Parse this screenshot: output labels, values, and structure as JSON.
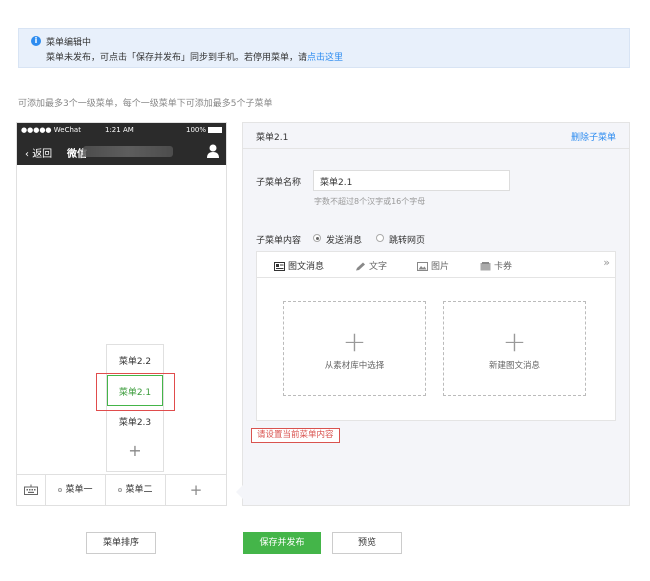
{
  "notice": {
    "title": "菜单编辑中",
    "desc_text": "菜单未发布，可点击「保存并发布」同步到手机。若停用菜单，请",
    "desc_link": "点击这里"
  },
  "tip": "可添加最多3个一级菜单，每个一级菜单下可添加最多5个子菜单",
  "phone": {
    "status": {
      "carrier": "●●●●● WeChat",
      "time": "1:21 AM",
      "battery": "100%"
    },
    "nav": {
      "back": "返回",
      "title": "微信"
    },
    "submenu": [
      "菜单2.2",
      "菜单2.1",
      "菜单2.3"
    ],
    "submenu_plus": "+",
    "menus": [
      "菜单一",
      "菜单二"
    ],
    "menu_plus": "+"
  },
  "editor": {
    "title": "菜单2.1",
    "delete": "删除子菜单",
    "name_label": "子菜单名称",
    "name_value": "菜单2.1",
    "name_hint": "字数不超过8个汉字或16个字母",
    "content_label": "子菜单内容",
    "options": [
      "发送消息",
      "跳转网页"
    ],
    "tabs": [
      "图文消息",
      "文字",
      "图片",
      "卡券"
    ],
    "more": "»",
    "cards": [
      "从素材库中选择",
      "新建图文消息"
    ],
    "error": "请设置当前菜单内容"
  },
  "buttons": {
    "sort": "菜单排序",
    "save": "保存并发布",
    "preview": "预览"
  },
  "colors": {
    "accent": "#44b549",
    "link": "#2d8cf0",
    "error": "#d9534f"
  }
}
